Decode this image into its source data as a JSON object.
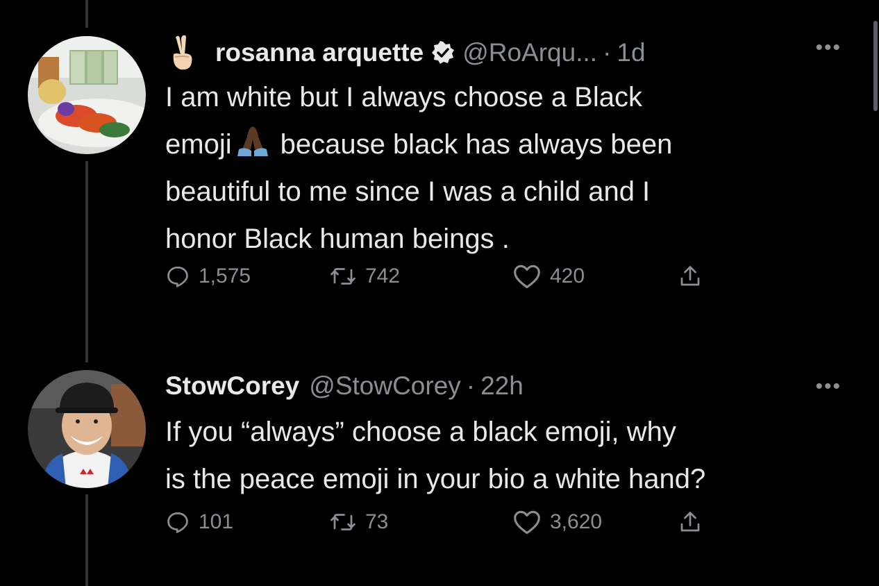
{
  "tweets": [
    {
      "display_name": "rosanna arquette",
      "verified": true,
      "handle": "@RoArqu...",
      "time": "1d",
      "name_prefix_icon": "victory-hand-icon",
      "text_line1": "I am white but I always choose a Black",
      "text_line2_pre": "emoji",
      "text_line2_icon": "folded-hands-dark-skin-icon",
      "text_line2_post": "because black has always been",
      "text_line3": "beautiful to me since I was a child and I",
      "text_line4": "honor Black human beings .",
      "replies": "1,575",
      "retweets": "742",
      "likes": "420"
    },
    {
      "display_name": "StowCorey",
      "verified": false,
      "handle": "@StowCorey",
      "time": "22h",
      "text_line1": "If you “always” choose a black emoji, why",
      "text_line2": "is the peace emoji in your bio a white hand?",
      "replies": "101",
      "retweets": "73",
      "likes": "3,620"
    }
  ],
  "ui": {
    "separator": "·",
    "more_label": "•••"
  },
  "colors": {
    "background": "#000000",
    "text_primary": "#e7e9ea",
    "text_secondary": "#8b8f94",
    "thread_line": "#333639"
  }
}
